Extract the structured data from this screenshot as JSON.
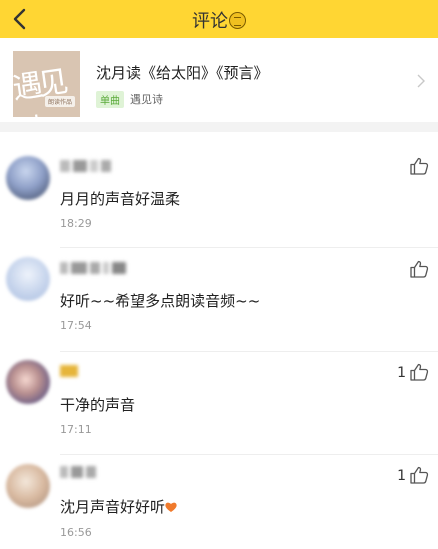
{
  "header": {
    "title": "评论",
    "back_icon": "chevron-left-icon",
    "title_emoji": "cartoon-face-emoji",
    "background": "#ffd633"
  },
  "song": {
    "cover_text": "遇见诗",
    "cover_tag": "朗读作品",
    "title": "沈月读《给太阳》《预言》",
    "badge": "单曲",
    "artist": "遇见诗",
    "chevron_icon": "chevron-right-icon"
  },
  "comments": [
    {
      "text": "月月的声音好温柔",
      "time": "18:29",
      "likes": ""
    },
    {
      "text": "好听~~希望多点朗读音频~~",
      "time": "17:54",
      "likes": ""
    },
    {
      "text": "干净的声音",
      "time": "17:11",
      "likes": "1"
    },
    {
      "text": "沈月声音好好听",
      "time": "16:56",
      "likes": "1",
      "trailing_emoji": "orange-heart"
    }
  ],
  "icons": {
    "like": "thumbs-up-icon"
  }
}
